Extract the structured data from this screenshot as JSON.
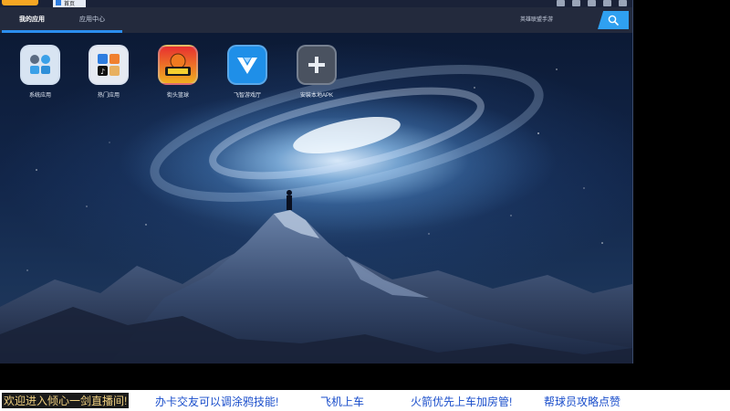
{
  "window": {
    "tab_label": "首页"
  },
  "navbar": {
    "tabs": [
      {
        "label": "我的应用",
        "active": true
      },
      {
        "label": "应用中心",
        "active": false
      }
    ],
    "search_label": "英雄联盟手游"
  },
  "apps": [
    {
      "label": "系统应用",
      "icon": "system-apps-folder-icon"
    },
    {
      "label": "热门应用",
      "icon": "hot-apps-folder-icon"
    },
    {
      "label": "街头篮球",
      "icon": "street-basketball-game-icon"
    },
    {
      "label": "飞智游戏厅",
      "icon": "flydigi-game-hall-icon"
    },
    {
      "label": "安装本地APK",
      "icon": "install-apk-plus-icon"
    }
  ],
  "ticker": [
    "欢迎进入倾心一剑直播间!",
    "办卡交友可以调涂鸦技能!",
    "飞机上车",
    "火箭优先上车加房管!",
    "帮球员攻略点赞"
  ],
  "colors": {
    "accent": "#2b8ef0",
    "ticker_text": "#1a4ecb",
    "highlight_text": "#f0d080"
  }
}
